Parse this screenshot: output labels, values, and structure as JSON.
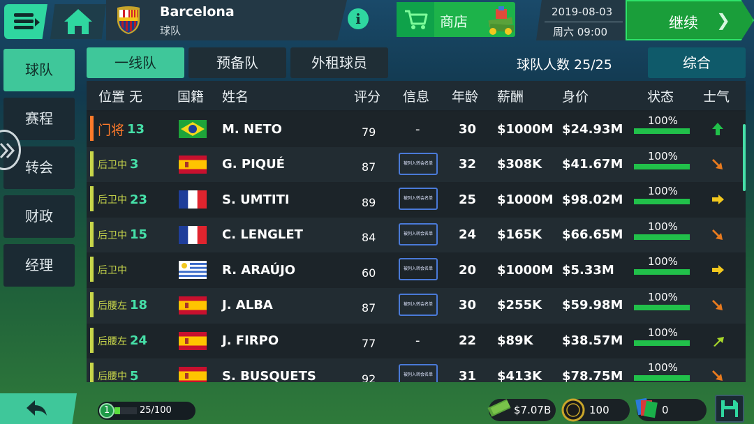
{
  "header": {
    "team_name": "Barcelona",
    "team_subtitle": "球队",
    "shop_label": "商店",
    "date": "2019-08-03",
    "time": "周六 09:00",
    "continue_label": "继续"
  },
  "sidebar": {
    "items": [
      {
        "label": "球队",
        "active": true
      },
      {
        "label": "赛程",
        "active": false
      },
      {
        "label": "转会",
        "active": false
      },
      {
        "label": "财政",
        "active": false
      },
      {
        "label": "经理",
        "active": false
      }
    ]
  },
  "tabs": [
    {
      "label": "一线队",
      "active": true
    },
    {
      "label": "预备队",
      "active": false
    },
    {
      "label": "外租球员",
      "active": false
    }
  ],
  "squad_count": "球队人数 25/25",
  "overview_label": "综合",
  "columns": [
    "位置 无",
    "国籍",
    "姓名",
    "评分",
    "信息",
    "年龄",
    "薪酬",
    "身价",
    "状态",
    "士气"
  ],
  "players": [
    {
      "position": "门将",
      "number": "13",
      "nationality": "brazil",
      "name": "M. NETO",
      "rating": "79",
      "info": "-",
      "age": "30",
      "wage": "$1000M",
      "value": "$24.93M",
      "condition": "100%",
      "condition_pct": 100,
      "morale": "up",
      "morale_color": "#21c04a",
      "gk": true
    },
    {
      "position": "后卫中",
      "number": "3",
      "nationality": "spain",
      "name": "G. PIQUÉ",
      "rating": "87",
      "info": "被列入转会名单",
      "age": "32",
      "wage": "$308K",
      "value": "$41.67M",
      "condition": "100%",
      "condition_pct": 100,
      "morale": "down-right",
      "morale_color": "#e87a1e",
      "gk": false
    },
    {
      "position": "后卫中",
      "number": "23",
      "nationality": "france",
      "name": "S. UMTITI",
      "rating": "89",
      "info": "被列入转会名单",
      "age": "25",
      "wage": "$1000M",
      "value": "$98.02M",
      "condition": "100%",
      "condition_pct": 100,
      "morale": "right",
      "morale_color": "#f2c81e",
      "gk": false
    },
    {
      "position": "后卫中",
      "number": "15",
      "nationality": "france",
      "name": "C. LENGLET",
      "rating": "84",
      "info": "被列入转会名单",
      "age": "24",
      "wage": "$165K",
      "value": "$66.65M",
      "condition": "100%",
      "condition_pct": 100,
      "morale": "down-right",
      "morale_color": "#e87a1e",
      "gk": false
    },
    {
      "position": "后卫中",
      "number": "",
      "nationality": "uruguay",
      "name": "R. ARAÚJO",
      "rating": "60",
      "info": "被列入转会名单",
      "age": "20",
      "wage": "$1000M",
      "value": "$5.33M",
      "condition": "100%",
      "condition_pct": 100,
      "morale": "right",
      "morale_color": "#f2c81e",
      "gk": false
    },
    {
      "position": "后腰左",
      "number": "18",
      "nationality": "spain",
      "name": "J. ALBA",
      "rating": "87",
      "info": "被列入转会名单",
      "age": "30",
      "wage": "$255K",
      "value": "$59.98M",
      "condition": "100%",
      "condition_pct": 100,
      "morale": "down-right",
      "morale_color": "#e87a1e",
      "gk": false
    },
    {
      "position": "后腰左",
      "number": "24",
      "nationality": "spain",
      "name": "J. FIRPO",
      "rating": "77",
      "info": "-",
      "age": "22",
      "wage": "$89K",
      "value": "$38.57M",
      "condition": "100%",
      "condition_pct": 100,
      "morale": "up-right",
      "morale_color": "#a8d82a",
      "gk": false
    },
    {
      "position": "后腰中",
      "number": "5",
      "nationality": "spain",
      "name": "S. BUSQUETS",
      "rating": "92",
      "info": "被列入转会名单",
      "age": "31",
      "wage": "$413K",
      "value": "$78.75M",
      "condition": "100%",
      "condition_pct": 100,
      "morale": "down-right",
      "morale_color": "#e87a1e",
      "gk": false
    }
  ],
  "footer": {
    "level": "1",
    "xp_text": "25/100",
    "xp_pct": 25,
    "cash": "$7.07B",
    "coins": "100",
    "cards": "0"
  }
}
